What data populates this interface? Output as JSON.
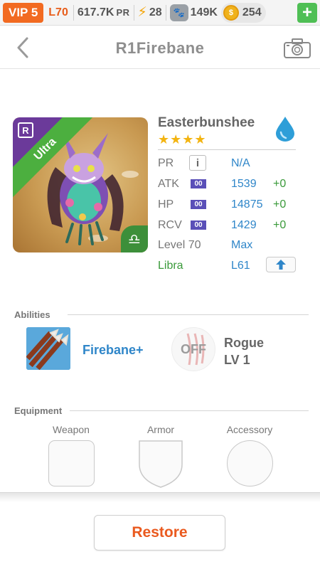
{
  "status_bar": {
    "vip": "VIP 5",
    "level": "L70",
    "pr_value": "617.7K",
    "pr_suffix": "PR",
    "energy": "28",
    "pets": "149K",
    "coins": "254",
    "icons": [
      "lightning-icon",
      "paw-icon",
      "coin-icon",
      "plus-icon"
    ]
  },
  "header": {
    "title": "R1Firebane",
    "icons": [
      "back-chevron-icon",
      "camera-icon"
    ]
  },
  "familiar": {
    "rarity": "Ultra",
    "name": "Easterbunshee",
    "stars": "★★★★",
    "element_icon": "water-drop-icon",
    "zodiac_icon": "libra-icon",
    "stats": {
      "pr_label": "PR",
      "pr_value": "N/A",
      "atk_label": "ATK",
      "atk_gem": "00",
      "atk_value": "1539",
      "atk_bonus": "+0",
      "hp_label": "HP",
      "hp_gem": "00",
      "hp_value": "14875",
      "hp_bonus": "+0",
      "rcv_label": "RCV",
      "rcv_gem": "00",
      "rcv_value": "1429",
      "rcv_bonus": "+0",
      "level_label": "Level 70",
      "level_value": "Max",
      "zodiac_label": "Libra",
      "zodiac_level": "L61"
    }
  },
  "abilities": {
    "title": "Abilities",
    "active_name": "Firebane+",
    "passive_state": "OFF",
    "passive_name": "Rogue",
    "passive_level": "LV 1"
  },
  "equipment": {
    "title": "Equipment",
    "slots": [
      "Weapon",
      "Armor",
      "Accessory"
    ]
  },
  "footer": {
    "restore_label": "Restore"
  },
  "colors": {
    "accent_orange": "#ea5a1f",
    "link_blue": "#2f86c9",
    "bonus_green": "#3a9a3a",
    "star_gold": "#f3b411"
  }
}
